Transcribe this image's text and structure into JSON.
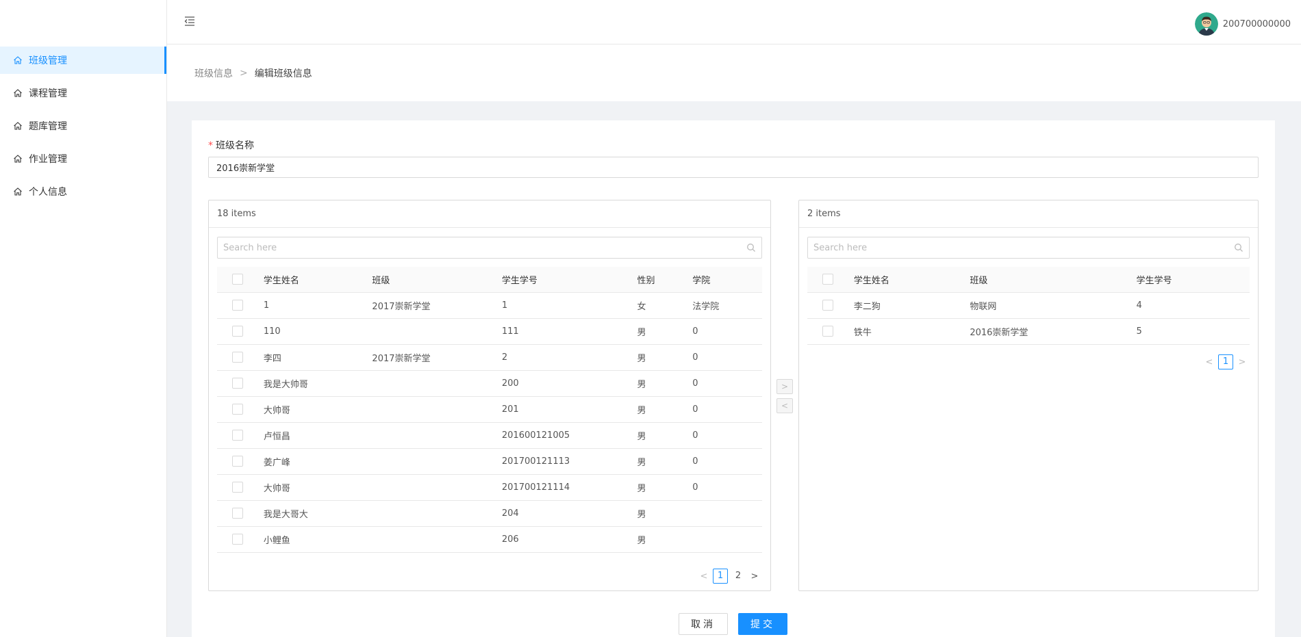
{
  "sidebar": {
    "items": [
      {
        "label": "班级管理",
        "active": true
      },
      {
        "label": "课程管理"
      },
      {
        "label": "题库管理"
      },
      {
        "label": "作业管理"
      },
      {
        "label": "个人信息"
      }
    ]
  },
  "header": {
    "menu_fold_icon": "menu-fold-icon",
    "username": "200700000000"
  },
  "breadcrumb": {
    "parent": "班级信息",
    "separator": ">",
    "current": "编辑班级信息"
  },
  "form": {
    "name_label": "班级名称",
    "required_mark": "*",
    "name_value": "2016崇新学堂"
  },
  "left_panel": {
    "count": "18 items",
    "search_placeholder": "Search here",
    "columns": [
      "学生姓名",
      "班级",
      "学生学号",
      "性别",
      "学院"
    ],
    "rows": [
      {
        "name": "1",
        "class": "2017崇新学堂",
        "id": "1",
        "gender": "女",
        "college": "法学院"
      },
      {
        "name": "110",
        "class": "",
        "id": "111",
        "gender": "男",
        "college": "0"
      },
      {
        "name": "李四",
        "class": "2017崇新学堂",
        "id": "2",
        "gender": "男",
        "college": "0"
      },
      {
        "name": "我是大帅哥",
        "class": "",
        "id": "200",
        "gender": "男",
        "college": "0"
      },
      {
        "name": "大帅哥",
        "class": "",
        "id": "201",
        "gender": "男",
        "college": "0"
      },
      {
        "name": "卢恒昌",
        "class": "",
        "id": "201600121005",
        "gender": "男",
        "college": "0"
      },
      {
        "name": "姜广峰",
        "class": "",
        "id": "201700121113",
        "gender": "男",
        "college": "0"
      },
      {
        "name": "大帅哥",
        "class": "",
        "id": "201700121114",
        "gender": "男",
        "college": "0"
      },
      {
        "name": "我是大哥大",
        "class": "",
        "id": "204",
        "gender": "男",
        "college": ""
      },
      {
        "name": "小鲤鱼",
        "class": "",
        "id": "206",
        "gender": "男",
        "college": ""
      }
    ],
    "pagination": {
      "prev": "<",
      "pages": [
        "1",
        "2"
      ],
      "current": "1",
      "next": ">"
    }
  },
  "right_panel": {
    "count": "2 items",
    "search_placeholder": "Search here",
    "columns": [
      "学生姓名",
      "班级",
      "学生学号"
    ],
    "rows": [
      {
        "name": "李二狗",
        "class": "物联网",
        "id": "4"
      },
      {
        "name": "铁牛",
        "class": "2016崇新学堂",
        "id": "5"
      }
    ],
    "pagination": {
      "prev": "<",
      "pages": [
        "1"
      ],
      "current": "1",
      "next": ">"
    }
  },
  "transfer": {
    "to_right": ">",
    "to_left": "<"
  },
  "actions": {
    "cancel": "取消",
    "submit": "提交"
  },
  "colors": {
    "primary": "#1890ff",
    "background": "#f0f2f5",
    "required": "#ff4d4f"
  }
}
